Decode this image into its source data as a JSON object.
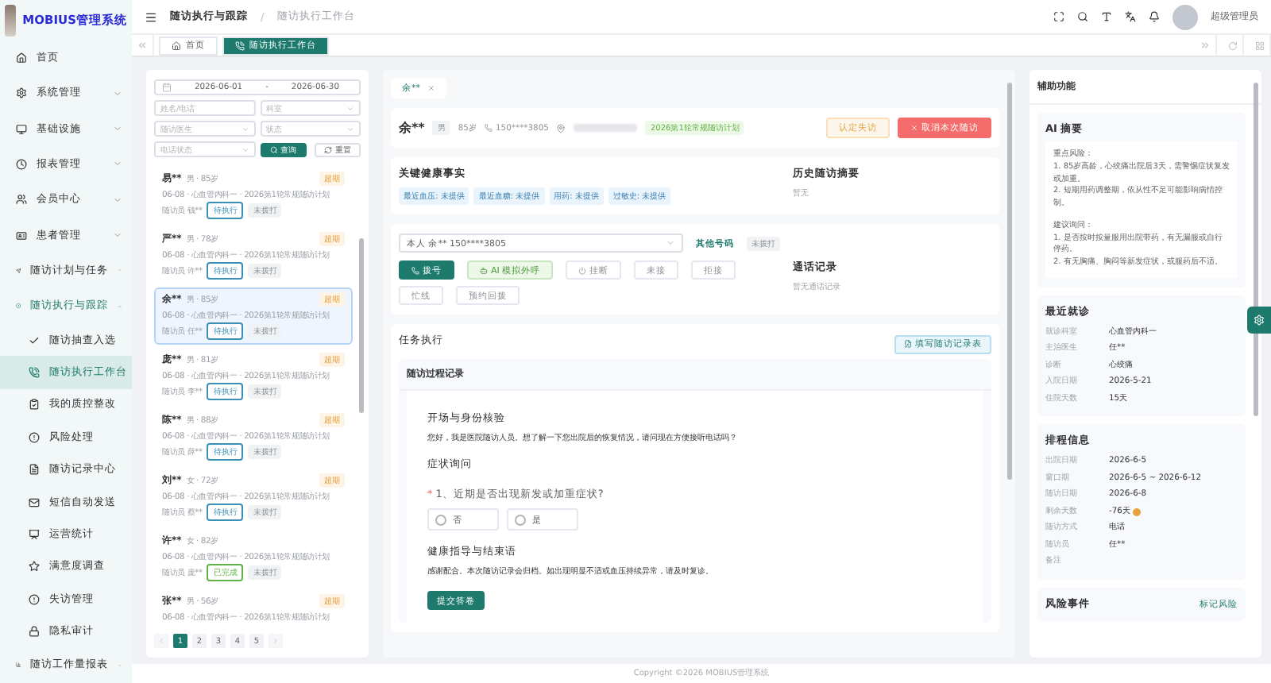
{
  "app": {
    "title": "MOBIUS管理系统"
  },
  "sidebar": {
    "items": [
      {
        "label": "首页",
        "selected": false
      },
      {
        "label": "系统管理",
        "expanded": false
      },
      {
        "label": "基础设施",
        "expanded": false
      },
      {
        "label": "报表管理",
        "expanded": false
      },
      {
        "label": "会员中心",
        "expanded": false
      },
      {
        "label": "患者管理",
        "expanded": false
      },
      {
        "label": "随访计划与任务",
        "expanded": false
      },
      {
        "label": "随访执行与跟踪",
        "expanded": true,
        "children": [
          {
            "label": "随访抽查入选",
            "selected": false
          },
          {
            "label": "随访执行工作台",
            "selected": true
          },
          {
            "label": "我的质控整改",
            "selected": false
          },
          {
            "label": "风险处理",
            "selected": false
          },
          {
            "label": "随访记录中心",
            "selected": false
          },
          {
            "label": "短信自动发送",
            "selected": false
          },
          {
            "label": "运营统计",
            "selected": false
          },
          {
            "label": "满意度调查",
            "selected": false
          },
          {
            "label": "失访管理",
            "selected": false
          },
          {
            "label": "隐私审计",
            "selected": false
          }
        ]
      },
      {
        "label": "随访工作量报表",
        "expanded": false
      }
    ]
  },
  "breadcrumb": [
    "随访执行与跟踪",
    "随访执行工作台"
  ],
  "breadcrumb_separator": "/",
  "user": {
    "name": "超级管理员"
  },
  "page_tabs": [
    {
      "label": "首页",
      "selected": false
    },
    {
      "label": "随访执行工作台",
      "selected": true
    }
  ],
  "filters": {
    "date_start": "2026-06-01",
    "date_separator": "-",
    "date_end": "2026-06-30",
    "fields": [
      {
        "placeholder": "姓名/电话",
        "kind": "input"
      },
      {
        "placeholder": "科室",
        "kind": "select"
      },
      {
        "placeholder": "随访医生",
        "kind": "select"
      },
      {
        "placeholder": "状态",
        "kind": "select"
      },
      {
        "placeholder": "电话状态",
        "kind": "select"
      }
    ],
    "search_button": "查询",
    "reset_button": "重置"
  },
  "patients": [
    {
      "name": "易**",
      "meta": "男 · 85岁",
      "badge": "超期",
      "info": "06-08 · 心血管内科一 · 2026第1轮常规随访计划",
      "staff": "随访员 钱**",
      "status": {
        "label": "待执行",
        "color": "#3a8fb7"
      },
      "call": "未拨打",
      "selected": false
    },
    {
      "name": "严**",
      "meta": "男 · 78岁",
      "badge": "超期",
      "info": "06-08 · 心血管内科一 · 2026第1轮常规随访计划",
      "staff": "随访员 许**",
      "status": {
        "label": "待执行",
        "color": "#3a8fb7"
      },
      "call": "未拨打",
      "selected": false
    },
    {
      "name": "余**",
      "meta": "男 · 85岁",
      "badge": "超期",
      "info": "06-08 · 心血管内科一 · 2026第1轮常规随访计划",
      "staff": "随访员 任**",
      "status": {
        "label": "待执行",
        "color": "#3a8fb7"
      },
      "call": "未拨打",
      "selected": true
    },
    {
      "name": "庞**",
      "meta": "男 · 81岁",
      "badge": "超期",
      "info": "06-08 · 心血管内科一 · 2026第1轮常规随访计划",
      "staff": "随访员 李**",
      "status": {
        "label": "待执行",
        "color": "#3a8fb7"
      },
      "call": "未拨打",
      "selected": false
    },
    {
      "name": "陈**",
      "meta": "男 · 88岁",
      "badge": "超期",
      "info": "06-08 · 心血管内科一 · 2026第1轮常规随访计划",
      "staff": "随访员 薛**",
      "status": {
        "label": "待执行",
        "color": "#3a8fb7"
      },
      "call": "未拨打",
      "selected": false
    },
    {
      "name": "刘**",
      "meta": "女 · 72岁",
      "badge": "超期",
      "info": "06-08 · 心血管内科一 · 2026第1轮常规随访计划",
      "staff": "随访员 蔡**",
      "status": {
        "label": "待执行",
        "color": "#3a8fb7"
      },
      "call": "未拨打",
      "selected": false
    },
    {
      "name": "许**",
      "meta": "女 · 82岁",
      "info": "06-08 · 心血管内科一 · 2026第1轮常规随访计划",
      "staff": "随访员 庞**",
      "status": {
        "label": "已完成",
        "color": "#5fb340"
      },
      "call": "未拨打",
      "selected": false
    },
    {
      "name": "张**",
      "meta": "男 · 56岁",
      "badge": "超期",
      "info": "06-08 · 心血管内科一 · 2026第1轮常规随访计划",
      "selected": false
    }
  ],
  "pagination": [
    {
      "label": "1",
      "selected": true
    },
    {
      "label": "2",
      "selected": false
    },
    {
      "label": "3",
      "selected": false
    },
    {
      "label": "4",
      "selected": false
    },
    {
      "label": "5",
      "selected": false
    }
  ],
  "open_tab": {
    "label": "余**"
  },
  "patient": {
    "name": "余**",
    "gender": "男",
    "age": "85岁",
    "phone": "150****3805",
    "plan": "2026第1轮常规随访计划",
    "actions": [
      {
        "label": "认定失访",
        "kind": "warning"
      },
      {
        "label": "取消本次随访",
        "kind": "danger"
      }
    ]
  },
  "health_facts": {
    "title": "关键健康事实",
    "tags": [
      "最近血压: 未提供",
      "最近血糖: 未提供",
      "用药: 未提供",
      "过敏史: 未提供"
    ],
    "history_title": "历史随访摘要",
    "history_text": "暂无"
  },
  "call": {
    "number_select": "本人 余** 150****3805",
    "other_numbers": "其他号码",
    "call_status": "未拨打",
    "buttons": [
      {
        "label": "拨号",
        "kind": "primary"
      },
      {
        "label": "AI 模拟外呼",
        "kind": "ai"
      },
      {
        "label": "挂断",
        "kind": "hangup"
      },
      {
        "label": "未接",
        "kind": "plain"
      },
      {
        "label": "拒接",
        "kind": "plain"
      },
      {
        "label": "忙线",
        "kind": "plain"
      },
      {
        "label": "预约回拨",
        "kind": "plain"
      }
    ],
    "log_title": "通话记录",
    "log_text": "暂无通话记录"
  },
  "task": {
    "title": "任务执行",
    "fill_button": "填写随访记录表",
    "record_title": "随访过程记录",
    "sections": [
      {
        "kind": "text",
        "title": "开场与身份核验",
        "text": "您好，我是医院随访人员。想了解一下您出院后的恢复情况，请问现在方便接听电话吗？"
      },
      {
        "kind": "question",
        "title": "症状询问",
        "question": "1、近期是否出现新发或加重症状?",
        "required_mark": "*",
        "options": [
          {
            "label": "否",
            "selected": false
          },
          {
            "label": "是",
            "selected": false
          }
        ]
      },
      {
        "kind": "text",
        "title": "健康指导与结束语",
        "text": "感谢配合。本次随访记录会归档。如出现明显不适或血压持续异常，请及时复诊。"
      }
    ],
    "submit_button": "提交答卷"
  },
  "assist": {
    "title": "辅助功能",
    "ai_summary": {
      "title": "AI 摘要",
      "paragraphs": [
        "重点风险：\n1. 85岁高龄，心绞痛出院后3天，需警惕症状复发或加重。\n2. 短期用药调整期，依从性不足可能影响病情控制。",
        "建议询问：\n1. 是否按时按量服用出院带药，有无漏服或自行停药。\n2. 有无胸痛、胸闷等新发症状，或服药后不适。"
      ]
    },
    "recent_visit": {
      "title": "最近就诊",
      "rows": [
        {
          "label": "就诊科室",
          "value": "心血管内科一"
        },
        {
          "label": "主治医生",
          "value": "任**"
        },
        {
          "label": "诊断",
          "value": "心绞痛"
        },
        {
          "label": "入院日期",
          "value": "2026-5-21"
        },
        {
          "label": "住院天数",
          "value": "15天"
        }
      ]
    },
    "schedule": {
      "title": "排程信息",
      "rows": [
        {
          "label": "出院日期",
          "value": "2026-6-5"
        },
        {
          "label": "窗口期",
          "value": "2026-6-5 ~ 2026-6-12"
        },
        {
          "label": "随访日期",
          "value": "2026-6-8"
        },
        {
          "label": "剩余天数",
          "value": "-76天",
          "warning": true
        },
        {
          "label": "随访方式",
          "value": "电话"
        },
        {
          "label": "随访员",
          "value": "任**"
        },
        {
          "label": "备注"
        }
      ]
    },
    "risk": {
      "title": "风险事件",
      "action": "标记风险"
    }
  },
  "footer": {
    "copyright": "Copyright ©2026 MOBIUS管理系统"
  }
}
